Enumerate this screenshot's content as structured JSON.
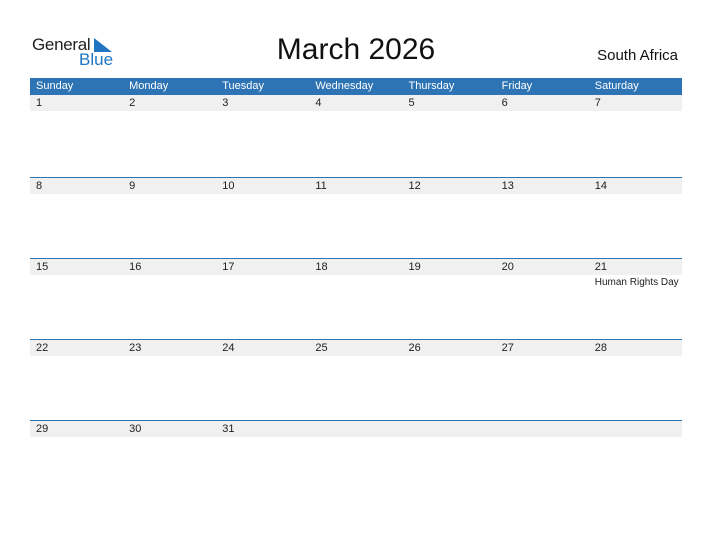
{
  "logo": {
    "general": "General",
    "blue": "Blue"
  },
  "title": "March 2026",
  "country": "South Africa",
  "days": [
    "Sunday",
    "Monday",
    "Tuesday",
    "Wednesday",
    "Thursday",
    "Friday",
    "Saturday"
  ],
  "weeks": [
    [
      {
        "d": "1"
      },
      {
        "d": "2"
      },
      {
        "d": "3"
      },
      {
        "d": "4"
      },
      {
        "d": "5"
      },
      {
        "d": "6"
      },
      {
        "d": "7"
      }
    ],
    [
      {
        "d": "8"
      },
      {
        "d": "9"
      },
      {
        "d": "10"
      },
      {
        "d": "11"
      },
      {
        "d": "12"
      },
      {
        "d": "13"
      },
      {
        "d": "14"
      }
    ],
    [
      {
        "d": "15"
      },
      {
        "d": "16"
      },
      {
        "d": "17"
      },
      {
        "d": "18"
      },
      {
        "d": "19"
      },
      {
        "d": "20"
      },
      {
        "d": "21",
        "e": "Human Rights Day"
      }
    ],
    [
      {
        "d": "22"
      },
      {
        "d": "23"
      },
      {
        "d": "24"
      },
      {
        "d": "25"
      },
      {
        "d": "26"
      },
      {
        "d": "27"
      },
      {
        "d": "28"
      }
    ],
    [
      {
        "d": "29"
      },
      {
        "d": "30"
      },
      {
        "d": "31"
      },
      {
        "d": ""
      },
      {
        "d": ""
      },
      {
        "d": ""
      },
      {
        "d": ""
      }
    ]
  ]
}
